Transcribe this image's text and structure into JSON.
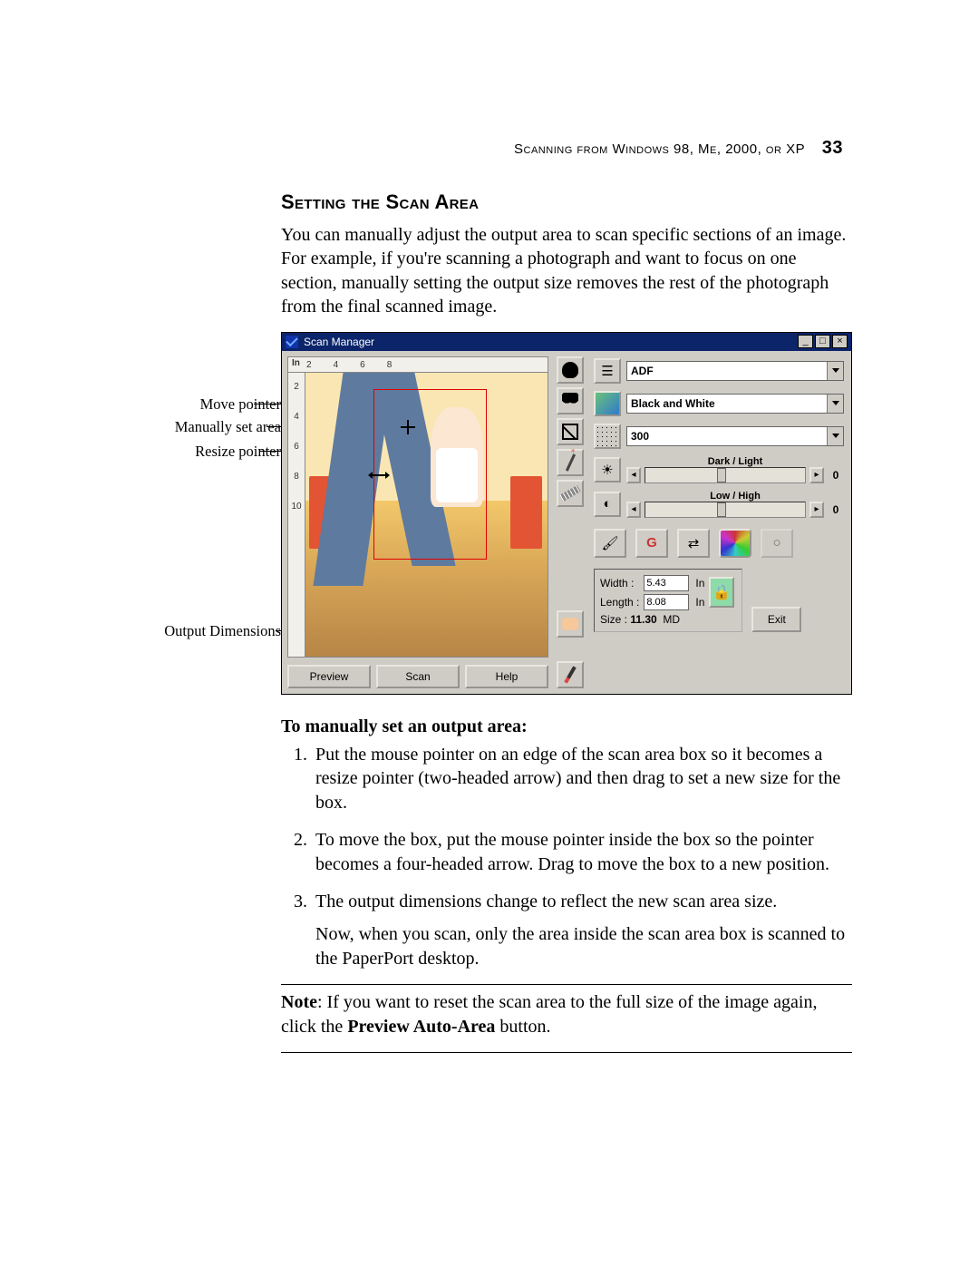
{
  "header": {
    "chapter_running": "Scanning from Windows 98, Me, 2000, or XP",
    "page_number": "33"
  },
  "section": {
    "title": "Setting the Scan Area",
    "intro": "You can manually adjust the output area to scan specific sections of an image. For example, if you're scanning a photograph and want to focus on one section, manually setting the output size removes the rest of the photograph from the final scanned image."
  },
  "callouts": {
    "move_pointer": "Move pointer",
    "manual_area": "Manually set area",
    "resize_pointer": "Resize pointer",
    "output_dims": "Output Dimensions"
  },
  "scanmgr": {
    "title": "Scan Manager",
    "ruler_unit": "In",
    "ruler_h": [
      "2",
      "4",
      "6",
      "8"
    ],
    "ruler_v": [
      "2",
      "4",
      "6",
      "8",
      "10"
    ],
    "buttons": {
      "preview": "Preview",
      "scan": "Scan",
      "help": "Help",
      "exit": "Exit"
    },
    "source": {
      "value": "ADF"
    },
    "mode": {
      "value": "Black and White"
    },
    "dpi": {
      "value": "300"
    },
    "slider_darklight": {
      "label": "Dark / Light",
      "value": "0"
    },
    "slider_lowhigh": {
      "label": "Low / High",
      "value": "0"
    },
    "dims": {
      "width_label": "Width :",
      "width": "5.43",
      "width_unit": "In",
      "length_label": "Length :",
      "length": "8.08",
      "length_unit": "In",
      "size_label": "Size :",
      "size": "11.30",
      "size_unit": "MD"
    }
  },
  "instructions": {
    "subhead": "To manually set an output area:",
    "steps": [
      "Put the mouse pointer on an edge of the scan area box so it becomes a resize pointer (two-headed arrow) and then drag to set a new size for the box.",
      "To move the box, put the mouse pointer inside the box so the pointer becomes a four-headed arrow. Drag to move the box to a new position.",
      "The output dimensions change to reflect the new scan area size."
    ],
    "step3_followup": "Now, when you scan, only the area inside the scan area box is scanned to the PaperPort desktop."
  },
  "note": {
    "label": "Note",
    "body_before": ":  If you want to reset the scan area to the full size of the image again, click the ",
    "bold": "Preview Auto-Area",
    "body_after": " button."
  }
}
